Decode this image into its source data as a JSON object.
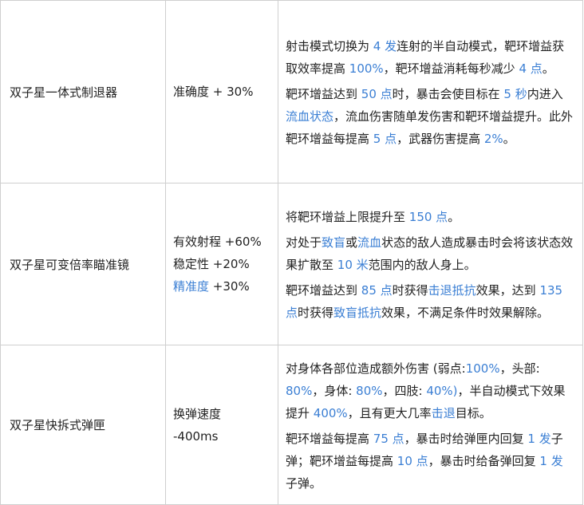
{
  "rows": [
    {
      "name": "双子星一体式制退器",
      "stats": [
        {
          "label": "准确度",
          "value": " + 30%",
          "highlight": false
        }
      ],
      "effects": [
        [
          {
            "t": "射击模式切换为 ",
            "h": false
          },
          {
            "t": "4 发",
            "h": true
          },
          {
            "t": "连射的半自动模式，靶环增益获取效率提高 ",
            "h": false
          },
          {
            "t": "100%",
            "h": true
          },
          {
            "t": "，靶环增益消耗每秒减少 ",
            "h": false
          },
          {
            "t": "4 点",
            "h": true
          },
          {
            "t": "。",
            "h": false
          }
        ],
        [
          {
            "t": "靶环增益达到 ",
            "h": false
          },
          {
            "t": "50 点",
            "h": true
          },
          {
            "t": "时，暴击会使目标在 ",
            "h": false
          },
          {
            "t": "5 秒",
            "h": true
          },
          {
            "t": "内进入",
            "h": false
          },
          {
            "t": "流血状态",
            "h": true
          },
          {
            "t": "，流血伤害随单发伤害和靶环增益提升。此外靶环增益每提高 ",
            "h": false
          },
          {
            "t": "5 点",
            "h": true
          },
          {
            "t": "，武器伤害提高 ",
            "h": false
          },
          {
            "t": "2%",
            "h": true
          },
          {
            "t": "。",
            "h": false
          }
        ]
      ]
    },
    {
      "name": "双子星可变倍率瞄准镜",
      "stats": [
        {
          "label": "有效射程",
          "value": " +60%",
          "highlight": false
        },
        {
          "label": "稳定性",
          "value": " +20%",
          "highlight": false
        },
        {
          "label": "精准度",
          "value": " +30%",
          "highlight": true
        }
      ],
      "effects": [
        [
          {
            "t": "将靶环增益上限提升至 ",
            "h": false
          },
          {
            "t": "150 点",
            "h": true
          },
          {
            "t": "。",
            "h": false
          }
        ],
        [
          {
            "t": "对处于",
            "h": false
          },
          {
            "t": "致盲",
            "h": true
          },
          {
            "t": "或",
            "h": false
          },
          {
            "t": "流血",
            "h": true
          },
          {
            "t": "状态的敌人造成暴击时会将该状态效果扩散至 ",
            "h": false
          },
          {
            "t": "10 米",
            "h": true
          },
          {
            "t": "范围内的敌人身上。",
            "h": false
          }
        ],
        [
          {
            "t": "靶环增益达到 ",
            "h": false
          },
          {
            "t": "85 点",
            "h": true
          },
          {
            "t": "时获得",
            "h": false
          },
          {
            "t": "击退抵抗",
            "h": true
          },
          {
            "t": "效果，达到 ",
            "h": false
          },
          {
            "t": "135 点",
            "h": true
          },
          {
            "t": "时获得",
            "h": false
          },
          {
            "t": "致盲抵抗",
            "h": true
          },
          {
            "t": "效果，不满足条件时效果解除。",
            "h": false
          }
        ]
      ]
    },
    {
      "name": "双子星快拆式弹匣",
      "stats": [
        {
          "label": "换弹速度",
          "value": "",
          "highlight": false
        },
        {
          "label": "-400ms",
          "value": "",
          "highlight": false
        }
      ],
      "effects": [
        [
          {
            "t": "对身体各部位造成额外伤害 (弱点:",
            "h": false
          },
          {
            "t": "100%",
            "h": true
          },
          {
            "t": "，头部: ",
            "h": false
          },
          {
            "t": "80%",
            "h": true
          },
          {
            "t": "，身体: ",
            "h": false
          },
          {
            "t": "80%",
            "h": true
          },
          {
            "t": "，四肢: ",
            "h": false
          },
          {
            "t": "40%)",
            "h": true
          },
          {
            "t": "，半自动模式下效果提升 ",
            "h": false
          },
          {
            "t": "400%",
            "h": true
          },
          {
            "t": "，且有更大几率",
            "h": false
          },
          {
            "t": "击退",
            "h": true
          },
          {
            "t": "目标。",
            "h": false
          }
        ],
        [
          {
            "t": "靶环增益每提高 ",
            "h": false
          },
          {
            "t": "75 点",
            "h": true
          },
          {
            "t": "，暴击时给弹匣内回复 ",
            "h": false
          },
          {
            "t": "1 发",
            "h": true
          },
          {
            "t": "子弹；靶环增益每提高 ",
            "h": false
          },
          {
            "t": "10 点",
            "h": true
          },
          {
            "t": "，暴击时给备弹回复 ",
            "h": false
          },
          {
            "t": "1 发",
            "h": true
          },
          {
            "t": "子弹。",
            "h": false
          }
        ]
      ]
    }
  ],
  "colors": {
    "highlight": "#3b7fd4",
    "text": "#222222",
    "border": "#cfcfcf"
  }
}
